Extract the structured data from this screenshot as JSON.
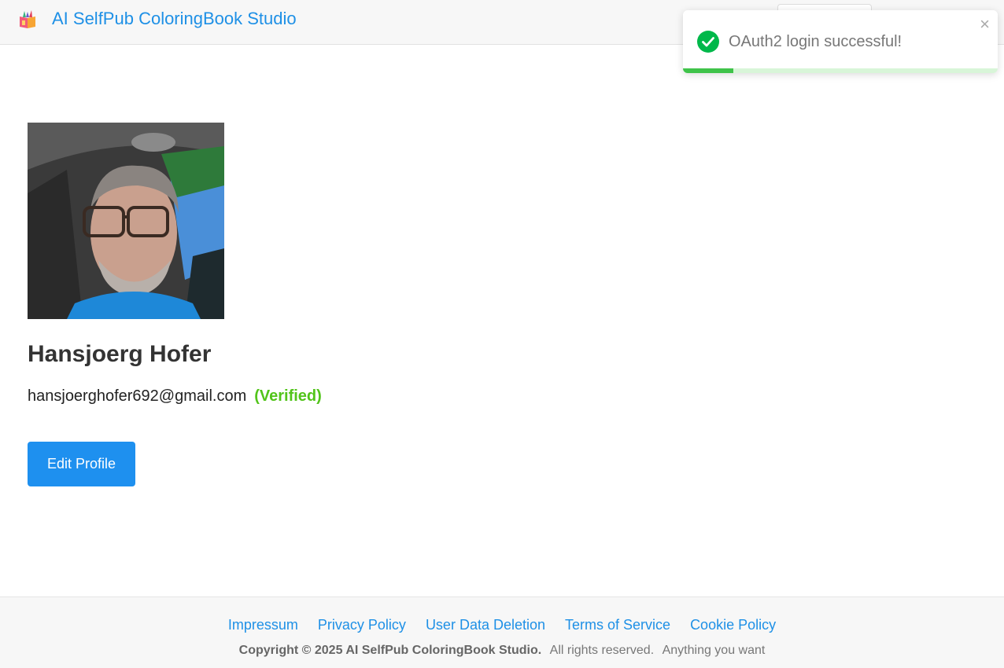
{
  "header": {
    "title": "AI SelfPub ColoringBook Studio",
    "logo_icon": "book-pencils-icon"
  },
  "toast": {
    "message": "OAuth2 login successful!",
    "icon": "check-circle-icon",
    "close": "×",
    "progress": 0.16,
    "color": "#00b84a"
  },
  "profile": {
    "name": "Hansjoerg Hofer",
    "email": "hansjoerghofer692@gmail.com",
    "verified": "(Verified)",
    "edit_button": "Edit Profile"
  },
  "footer": {
    "links": [
      "Impressum",
      "Privacy Policy",
      "User Data Deletion",
      "Terms of Service",
      "Cookie Policy"
    ],
    "copyright_bold": "Copyright © 2025 AI SelfPub ColoringBook Studio.",
    "rights": "All rights reserved.",
    "tagline": "Anything you want"
  },
  "colors": {
    "accent": "#1e90ef",
    "verified": "#52c41a",
    "toast_progress": "#3fc34a"
  }
}
